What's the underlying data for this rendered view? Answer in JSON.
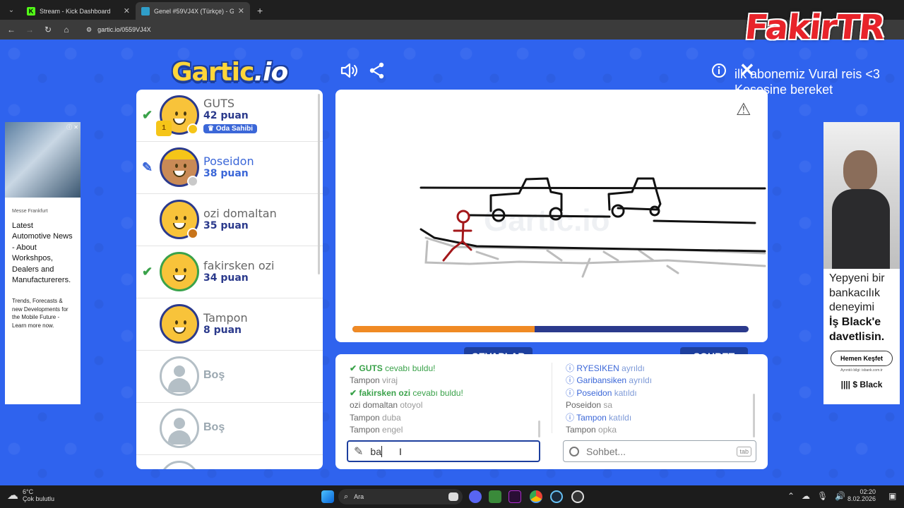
{
  "browser": {
    "tabs": [
      {
        "title": "Stream - Kick Dashboard",
        "favicon_color": "#53fc18",
        "active": false
      },
      {
        "title": "Genel #59VJ4X (Türkçe) - Gartic",
        "favicon_color": "#2f9ec9",
        "active": true
      }
    ],
    "url": "gartic.io/0559VJ4X"
  },
  "overlay": {
    "logo_text": "FakirTR"
  },
  "header": {
    "logo_main": "Gartic",
    "logo_suffix": ".io",
    "ticker_line1": "ilk abonemiz Vural reis <3",
    "ticker_line2": "Kesesine bereket"
  },
  "players": [
    {
      "name": "GUTS",
      "points": "42 puan",
      "badge": "Oda Sahibi",
      "mark": "check",
      "dot_color": "#f5c518",
      "trophy": "1"
    },
    {
      "name": "Poseidon",
      "points": "38 puan",
      "mark": "pencil",
      "dot_color": "#c9c9c9",
      "drawing": true
    },
    {
      "name": "ozi domaltan",
      "points": "35 puan",
      "mark": "",
      "dot_color": "#c8741a"
    },
    {
      "name": "fakirsken ozi",
      "points": "34 puan",
      "mark": "check",
      "dot_color": ""
    },
    {
      "name": "Tampon",
      "points": "8 puan",
      "mark": "",
      "dot_color": ""
    }
  ],
  "empty_slots": [
    "Boş",
    "Boş"
  ],
  "canvas": {
    "timer_progress": 0.46,
    "watermark": "Gartic.io"
  },
  "answers": {
    "tab_label": "CEVAPLAR",
    "messages": [
      {
        "type": "ok",
        "user": "GUTS",
        "text": "cevabı buldu!"
      },
      {
        "type": "msg",
        "user": "Tampon",
        "text": "viraj"
      },
      {
        "type": "ok",
        "user": "fakirsken ozi",
        "text": "cevabı buldu!"
      },
      {
        "type": "msg",
        "user": "ozi domaltan",
        "text": "otoyol"
      },
      {
        "type": "msg",
        "user": "Tampon",
        "text": "duba"
      },
      {
        "type": "msg",
        "user": "Tampon",
        "text": "engel"
      }
    ],
    "input_value": "ba"
  },
  "chat": {
    "tab_label": "SOHBET",
    "messages": [
      {
        "type": "info",
        "user": "RYESIKEN",
        "text": "ayrıldı"
      },
      {
        "type": "info",
        "user": "Garibansiken",
        "text": "ayrıldı"
      },
      {
        "type": "info",
        "user": "Poseidon",
        "text": "katıldı"
      },
      {
        "type": "msg",
        "user": "Poseidon",
        "text": "sa"
      },
      {
        "type": "info",
        "user": "Tampon",
        "text": "katıldı"
      },
      {
        "type": "msg",
        "user": "Tampon",
        "text": "opka"
      }
    ],
    "input_placeholder": "Sohbet...",
    "tab_hint": "tab"
  },
  "ad_left": {
    "source": "Messe Frankfurt",
    "headline": "Latest Automotive News - About Workshpos, Dealers and Manufacturerers.",
    "body": "Trends, Forecasts & new Developments for the Mobile Future - Learn more now."
  },
  "ad_right": {
    "line1": "Yepyeni bir bankacılık deneyimi",
    "line2": "İş Black'e davetlisin.",
    "cta": "Hemen Keşfet",
    "small": "Ayrıntılı bilgi: isbank.com.tr",
    "brand": "Black"
  },
  "taskbar": {
    "weather_temp": "6°C",
    "weather_desc": "Çok bulutlu",
    "search_label": "Ara",
    "time": "02:20",
    "date": "8.02.2026"
  }
}
